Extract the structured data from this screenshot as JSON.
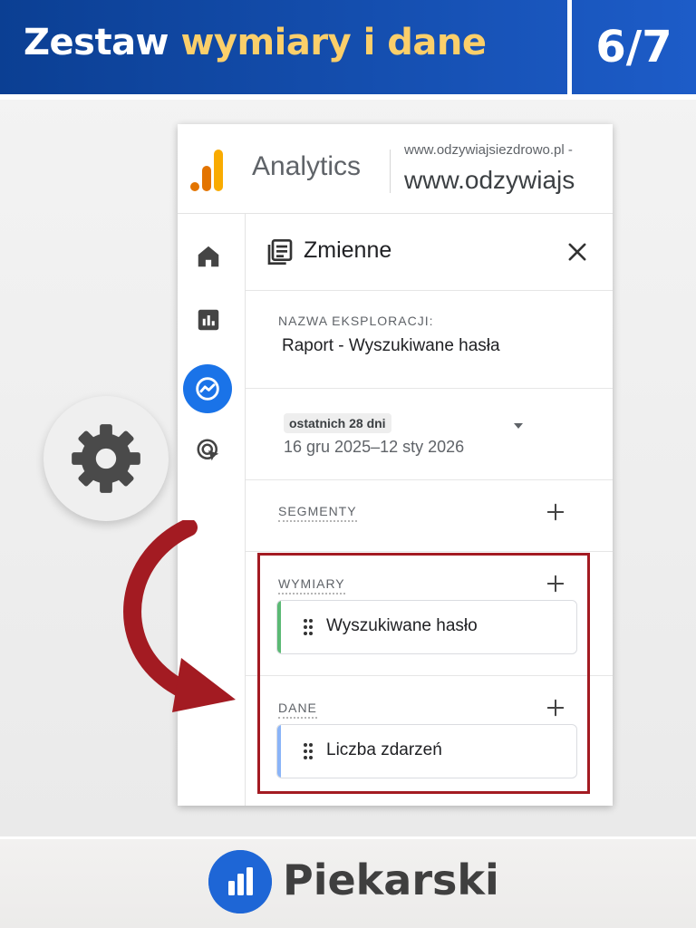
{
  "banner": {
    "title_part1": "Zestaw ",
    "title_highlight": "wymiary i dane",
    "page_indicator": "6/7"
  },
  "app": {
    "name": "Analytics",
    "property_domain": "www.odzywiajsiezdrowo.pl -",
    "property_name": "www.odzywiajs"
  },
  "nav_rail": {
    "items": [
      "home-icon",
      "reports-icon",
      "explore-icon",
      "advertising-icon"
    ],
    "active_item": "explore-icon"
  },
  "variables_panel": {
    "title": "Zmienne",
    "exploration_name_label": "NAZWA EKSPLORACJI:",
    "exploration_name_value": "Raport - Wyszukiwane hasła",
    "date_preset": "ostatnich 28 dni",
    "date_range": "16 gru 2025–12 sty 2026",
    "segments_label": "SEGMENTY",
    "dimensions_label": "WYMIARY",
    "dimensions": [
      "Wyszukiwane hasło"
    ],
    "metrics_label": "DANE",
    "metrics": [
      "Liczba zdarzeń"
    ]
  },
  "colors": {
    "banner_blue": "#1d5cc8",
    "banner_highlight": "#fbcf6a",
    "ga_orange": "#f9ab00",
    "ga_active_blue": "#1a73e8",
    "dimension_green": "#5bb974",
    "metric_blue": "#8ab4f8",
    "highlight_red": "#a31b22"
  },
  "footer": {
    "brand": "Piekarski"
  }
}
